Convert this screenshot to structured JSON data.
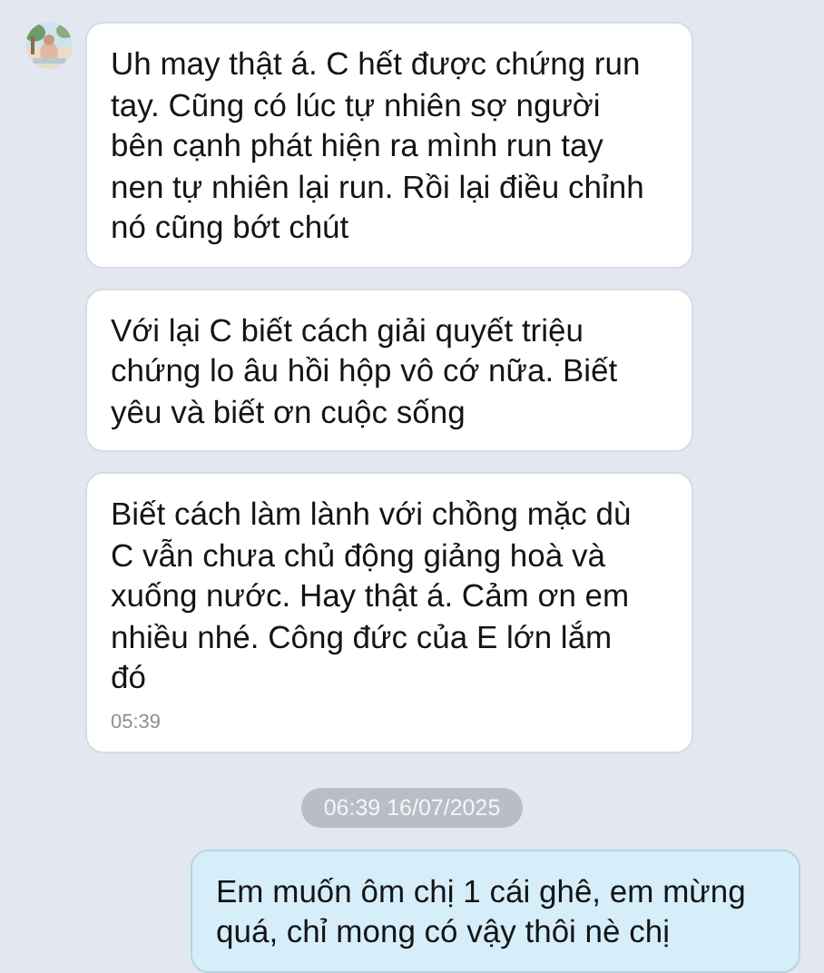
{
  "messages": [
    {
      "kind": "incoming",
      "avatar": true,
      "text": "Uh may thật á. C hết được chứng run tay. Cũng có lúc tự nhiên sợ người bên cạnh phát hiện ra mình run tay nen tự nhiên lại run. Rồi lại điều chỉnh nó cũng bớt chút"
    },
    {
      "kind": "incoming",
      "avatar": false,
      "text": "Với lại C biết cách giải quyết triệu chứng lo âu hồi hộp vô cớ nữa. Biết yêu và biết ơn cuộc sống"
    },
    {
      "kind": "incoming",
      "avatar": false,
      "text": "Biết cách làm lành với chồng mặc dù C vẫn chưa chủ động giảng hoà và xuống nước. Hay thật á. Cảm ơn em nhiều nhé. Công đức của E lớn lắm đó",
      "time": "05:39"
    },
    {
      "kind": "timestamp",
      "text": "06:39 16/07/2025"
    },
    {
      "kind": "outgoing",
      "text": "Em muốn ôm chị 1 cái ghê, em mừng quá, chỉ mong có vậy thôi nè chị"
    }
  ]
}
